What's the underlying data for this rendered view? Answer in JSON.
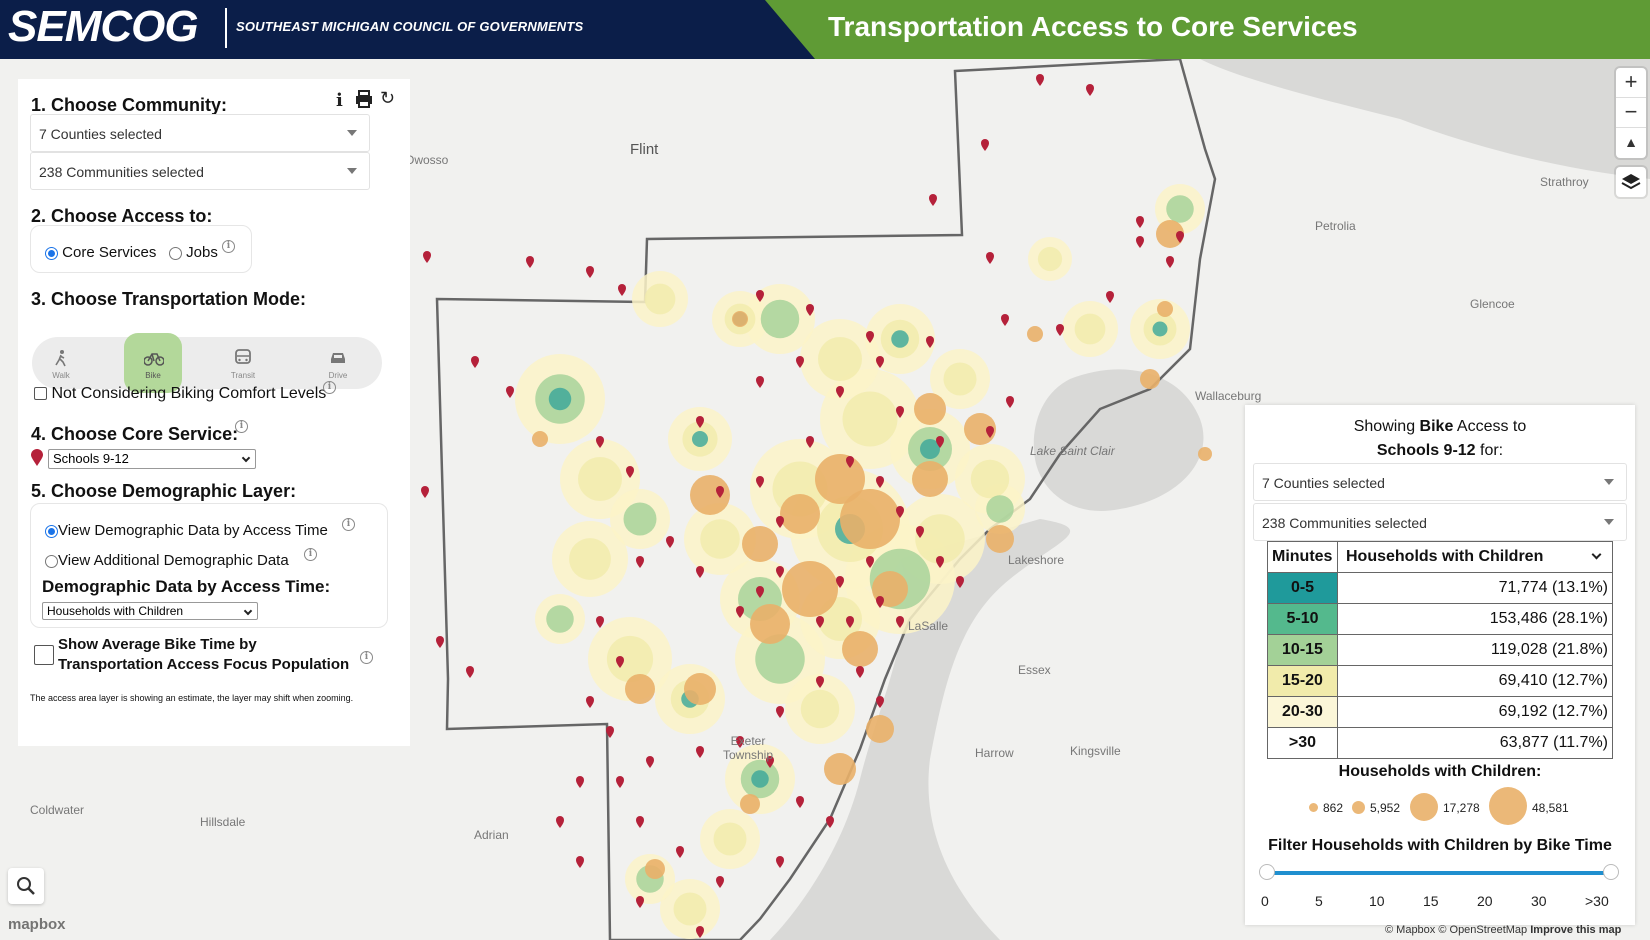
{
  "header": {
    "logo": "SEMCOG",
    "logo_subtitle": "SOUTHEAST MICHIGAN COUNCIL OF GOVERNMENTS",
    "title": "Transportation Access to Core Services"
  },
  "left_panel": {
    "step1_title": "1. Choose Community:",
    "counties_select": "7 Counties selected",
    "communities_select": "238 Communities selected",
    "step2_title": "2. Choose Access to:",
    "access_options": [
      "Core Services",
      "Jobs"
    ],
    "access_selected": "Core Services",
    "step3_title": "3. Choose Transportation Mode:",
    "modes": [
      "Walk",
      "Bike",
      "Transit",
      "Drive"
    ],
    "mode_selected": "Bike",
    "comfort_checkbox_label": "Not Considering Biking Comfort Levels",
    "step4_title": "4. Choose Core Service:",
    "core_service_selected": "Schools 9-12",
    "step5_title": "5. Choose Demographic Layer:",
    "demo_options": [
      "View Demographic Data by Access Time",
      "View Additional Demographic Data"
    ],
    "demo_subtitle": "Demographic Data by Access Time:",
    "demo_select": "Households with Children",
    "avg_bike_checkbox_line1": "Show Average Bike Time by",
    "avg_bike_checkbox_line2": "Transportation Access Focus Population",
    "footnote": "The access area layer is showing an estimate, the layer may shift when zooming."
  },
  "map_labels": [
    "Flint",
    "Owosso",
    "Strathroy",
    "Petrolia",
    "Glencoe",
    "Wallaceburg",
    "Lake Saint Clair",
    "Lakeshore",
    "LaSalle",
    "Essex",
    "Harrow",
    "Kingsville",
    "Exeter Township",
    "Adrian",
    "Hillsdale",
    "Coldwater"
  ],
  "right_panel": {
    "heading_prefix": "Showing ",
    "heading_mode": "Bike",
    "heading_suffix": " Access to",
    "heading_service": "Schools 9-12",
    "heading_for": " for:",
    "counties_select": "7 Counties selected",
    "communities_select": "238 Communities selected",
    "table_header_minutes": "Minutes",
    "table_header_metric": "Households with Children",
    "rows": [
      {
        "minutes": "0-5",
        "value": "71,774 (13.1%)",
        "color": "#1f9a9b"
      },
      {
        "minutes": "5-10",
        "value": "153,486 (28.1%)",
        "color": "#54b98d"
      },
      {
        "minutes": "10-15",
        "value": "119,028 (21.8%)",
        "color": "#a3d197"
      },
      {
        "minutes": "15-20",
        "value": "69,410 (12.7%)",
        "color": "#f1ebab"
      },
      {
        "minutes": "20-30",
        "value": "69,192 (12.7%)",
        "color": "#fbf6d8"
      },
      {
        "minutes": ">30",
        "value": "63,877 (11.7%)",
        "color": "#ffffff"
      }
    ],
    "legend_title": "Households with Children:",
    "legend_sizes": [
      "862",
      "5,952",
      "17,278",
      "48,581"
    ],
    "filter_title": "Filter Households with Children by Bike Time",
    "slider_ticks": [
      "0",
      "5",
      "10",
      "15",
      "20",
      "30",
      ">30"
    ],
    "slider_range": [
      "0",
      ">30"
    ]
  },
  "attribution": "© Mapbox © OpenStreetMap",
  "improve_map": "Improve this map",
  "mapbox_logo": "mapbox",
  "colors": {
    "header_navy": "#0b1e49",
    "header_green": "#5f9b35",
    "pin_red": "#b5213a",
    "circle_orange": "#e9b069"
  }
}
